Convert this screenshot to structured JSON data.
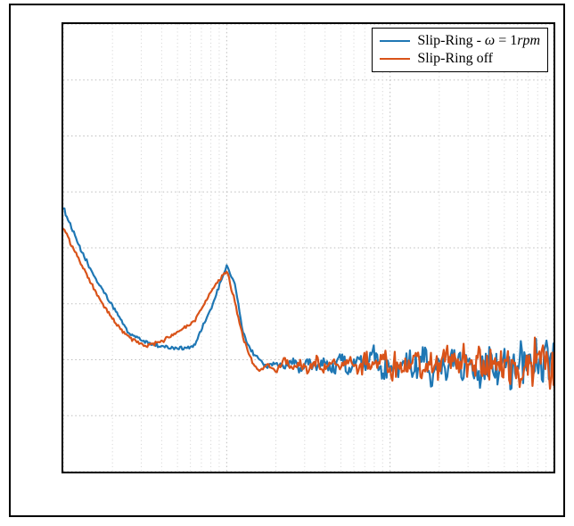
{
  "chart_data": {
    "type": "line",
    "title": "",
    "xlabel": "",
    "ylabel": "",
    "x_scale": "log",
    "y_scale": "linear",
    "xlim_log10": [
      0.0,
      3.0
    ],
    "ylim": [
      0.0,
      1.0
    ],
    "x_major_ticks": [
      1,
      10,
      100,
      1000
    ],
    "y_major_ticks": [
      0.0,
      0.125,
      0.25,
      0.375,
      0.5,
      0.625,
      0.75,
      0.875,
      1.0
    ],
    "legend_position": "upper right",
    "colors": {
      "slip_ring_1rpm": "#1f77b4",
      "slip_ring_off": "#d95319"
    },
    "series": [
      {
        "name": "Slip-Ring - ω = 1rpm",
        "legend_html": "Slip-Ring - <i>&omega;</i> = 1<i>rpm</i>",
        "color": "#1f77b4",
        "x": [
          1.0,
          1.26,
          1.58,
          2.0,
          2.51,
          3.16,
          3.98,
          5.01,
          6.31,
          7.94,
          10.0,
          11.2,
          12.6,
          14.1,
          15.8,
          17.8,
          20.0,
          22.4,
          25.1,
          28.2,
          31.6,
          35.5,
          39.8,
          44.7,
          50.1,
          56.2,
          63.1,
          70.8,
          79.4,
          89.1,
          100.0,
          112.0,
          126.0,
          141.0,
          158.0,
          178.0,
          200.0,
          224.0,
          251.0,
          282.0,
          316.0,
          355.0,
          398.0,
          447.0,
          501.0,
          562.0,
          631.0,
          708.0,
          794.0,
          891.0,
          1000.0
        ],
        "y": [
          0.59,
          0.5,
          0.43,
          0.37,
          0.31,
          0.29,
          0.28,
          0.275,
          0.28,
          0.36,
          0.46,
          0.42,
          0.31,
          0.27,
          0.25,
          0.235,
          0.245,
          0.23,
          0.25,
          0.225,
          0.245,
          0.23,
          0.255,
          0.225,
          0.26,
          0.22,
          0.255,
          0.23,
          0.265,
          0.22,
          0.255,
          0.23,
          0.26,
          0.22,
          0.275,
          0.215,
          0.26,
          0.23,
          0.25,
          0.225,
          0.265,
          0.22,
          0.255,
          0.235,
          0.25,
          0.225,
          0.26,
          0.23,
          0.255,
          0.235,
          0.24
        ]
      },
      {
        "name": "Slip-Ring off",
        "legend_html": "Slip-Ring off",
        "color": "#d95319",
        "x": [
          1.0,
          1.26,
          1.58,
          2.0,
          2.51,
          3.16,
          3.98,
          5.01,
          6.31,
          7.94,
          10.0,
          11.2,
          12.6,
          14.1,
          15.8,
          17.8,
          20.0,
          22.4,
          25.1,
          28.2,
          31.6,
          35.5,
          39.8,
          44.7,
          50.1,
          56.2,
          63.1,
          70.8,
          79.4,
          89.1,
          100.0,
          112.0,
          126.0,
          141.0,
          158.0,
          178.0,
          200.0,
          224.0,
          251.0,
          282.0,
          316.0,
          355.0,
          398.0,
          447.0,
          501.0,
          562.0,
          631.0,
          708.0,
          794.0,
          891.0,
          1000.0
        ],
        "y": [
          0.545,
          0.47,
          0.4,
          0.34,
          0.3,
          0.28,
          0.29,
          0.31,
          0.335,
          0.4,
          0.45,
          0.38,
          0.3,
          0.25,
          0.225,
          0.24,
          0.22,
          0.255,
          0.23,
          0.24,
          0.225,
          0.25,
          0.225,
          0.245,
          0.23,
          0.255,
          0.225,
          0.245,
          0.235,
          0.26,
          0.225,
          0.25,
          0.23,
          0.26,
          0.22,
          0.25,
          0.23,
          0.255,
          0.235,
          0.245,
          0.225,
          0.25,
          0.23,
          0.245,
          0.235,
          0.255,
          0.225,
          0.245,
          0.235,
          0.25,
          0.23
        ]
      }
    ]
  },
  "legend": {
    "items": [
      {
        "color": "#1f77b4",
        "label_html": "Slip-Ring - <i>&omega;</i> = 1<i>rpm</i>"
      },
      {
        "color": "#d95319",
        "label_html": "Slip-Ring off"
      }
    ]
  }
}
